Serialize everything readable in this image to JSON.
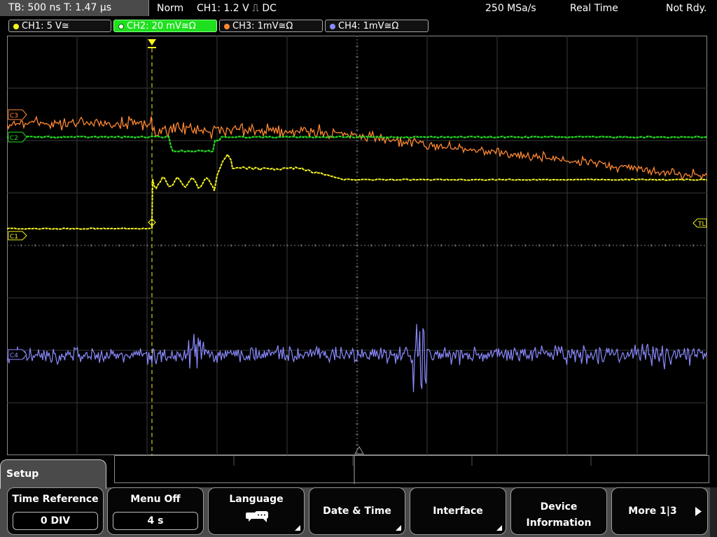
{
  "status": {
    "timebase": "TB: 500 ns   T: 1.47 µs",
    "trigger_mode": "Norm",
    "trigger_info": "CH1: 1.2 V ⎍ DC",
    "sample_rate": "250 MSa/s",
    "acq_mode": "Real Time",
    "state": "Not Rdy."
  },
  "channels": [
    {
      "label": "CH1: 5 V≅",
      "color": "#f5f520",
      "active": false
    },
    {
      "label": "CH2: 20 mV≅Ω",
      "color": "#22dd22",
      "active": true
    },
    {
      "label": "CH3: 1mV≅Ω",
      "color": "#ff8833",
      "active": false
    },
    {
      "label": "CH4: 1mV≅Ω",
      "color": "#8a8aff",
      "active": false
    }
  ],
  "markers": {
    "c3": "C3",
    "c2": "C2",
    "c1": "C1",
    "c4": "C4",
    "trigger_level": "TL"
  },
  "menu": {
    "title": "Setup",
    "keys": [
      {
        "label": "Time Reference",
        "value": "0 DIV"
      },
      {
        "label": "Menu Off",
        "value": "4 s"
      },
      {
        "label": "Language",
        "icon": "speech-bubbles-icon"
      },
      {
        "label": "Date & Time"
      },
      {
        "label": "Interface"
      },
      {
        "label_line1": "Device",
        "label_line2": "Information"
      },
      {
        "label": "More 1|3"
      }
    ]
  }
}
